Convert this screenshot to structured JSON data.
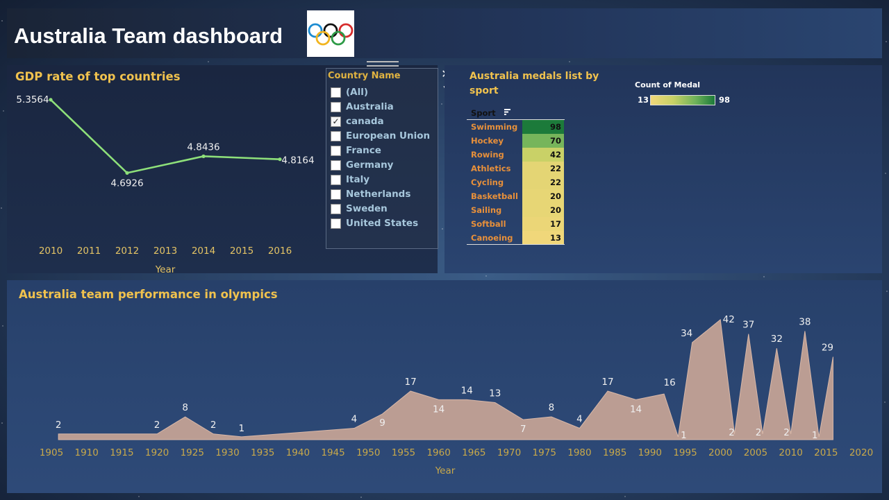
{
  "header": {
    "title": "Australia Team dashboard"
  },
  "gdp": {
    "title": "GDP rate of top countries",
    "xlabel": "Year"
  },
  "filter": {
    "title": "Country Name",
    "items": [
      {
        "label": "(All)",
        "checked": false
      },
      {
        "label": "Australia",
        "checked": false
      },
      {
        "label": "canada",
        "checked": true
      },
      {
        "label": "European Union",
        "checked": false
      },
      {
        "label": "France",
        "checked": false
      },
      {
        "label": "Germany",
        "checked": false
      },
      {
        "label": "Italy",
        "checked": false
      },
      {
        "label": "Netherlands",
        "checked": false
      },
      {
        "label": "Sweden",
        "checked": false
      },
      {
        "label": "United States",
        "checked": false
      }
    ],
    "close_icon": "close-icon",
    "dropdown_icon": "dropdown-arrow-icon"
  },
  "medals": {
    "title": "Australia medals list by sport",
    "legend_title": "Count of Medal",
    "legend_min": "13",
    "legend_max": "98",
    "column_header": "Sport",
    "sort_icon": "sort-icon"
  },
  "perf": {
    "title": "Australia team performance in olympics",
    "xlabel": "Year"
  },
  "colors": {
    "accent_title": "#f0c24e",
    "gdp_line": "#8ee07a",
    "area_fill": "#c8a596",
    "sport_name": "#e8903a"
  },
  "chart_data": [
    {
      "type": "line",
      "title": "GDP rate of top countries",
      "xlabel": "Year",
      "ylabel": "",
      "x_ticks": [
        2010,
        2011,
        2012,
        2013,
        2014,
        2015,
        2016
      ],
      "x": [
        2010,
        2012,
        2014,
        2016
      ],
      "values": [
        5.3564,
        4.6926,
        4.8436,
        4.8164
      ],
      "labels": [
        "5.3564",
        "4.6926",
        "4.8436",
        "4.8164"
      ],
      "grid": false
    },
    {
      "type": "heatmap",
      "title": "Australia medals list by sport",
      "column_header": "Sport",
      "categories": [
        "Swimming",
        "Hockey",
        "Rowing",
        "Athletics",
        "Cycling",
        "Basketball",
        "Sailing",
        "Softball",
        "Canoeing"
      ],
      "values": [
        98,
        70,
        42,
        22,
        22,
        20,
        20,
        17,
        13
      ],
      "legend": {
        "title": "Count of Medal",
        "min": 13,
        "max": 98
      }
    },
    {
      "type": "area",
      "title": "Australia team performance in olympics",
      "xlabel": "Year",
      "x_ticks": [
        1905,
        1910,
        1915,
        1920,
        1925,
        1930,
        1935,
        1940,
        1945,
        1950,
        1955,
        1960,
        1965,
        1970,
        1975,
        1980,
        1985,
        1990,
        1995,
        2000,
        2005,
        2010,
        2015,
        2020
      ],
      "x": [
        1906,
        1920,
        1924,
        1928,
        1932,
        1948,
        1952,
        1956,
        1960,
        1964,
        1968,
        1972,
        1976,
        1980,
        1984,
        1988,
        1992,
        1994,
        1996,
        2000,
        2002,
        2004,
        2006,
        2008,
        2010,
        2012,
        2014,
        2016
      ],
      "values": [
        2,
        2,
        8,
        2,
        1,
        4,
        9,
        17,
        14,
        14,
        13,
        7,
        8,
        4,
        17,
        14,
        16,
        1,
        34,
        42,
        2,
        37,
        2,
        32,
        2,
        38,
        1,
        29
      ],
      "grid": false
    }
  ]
}
